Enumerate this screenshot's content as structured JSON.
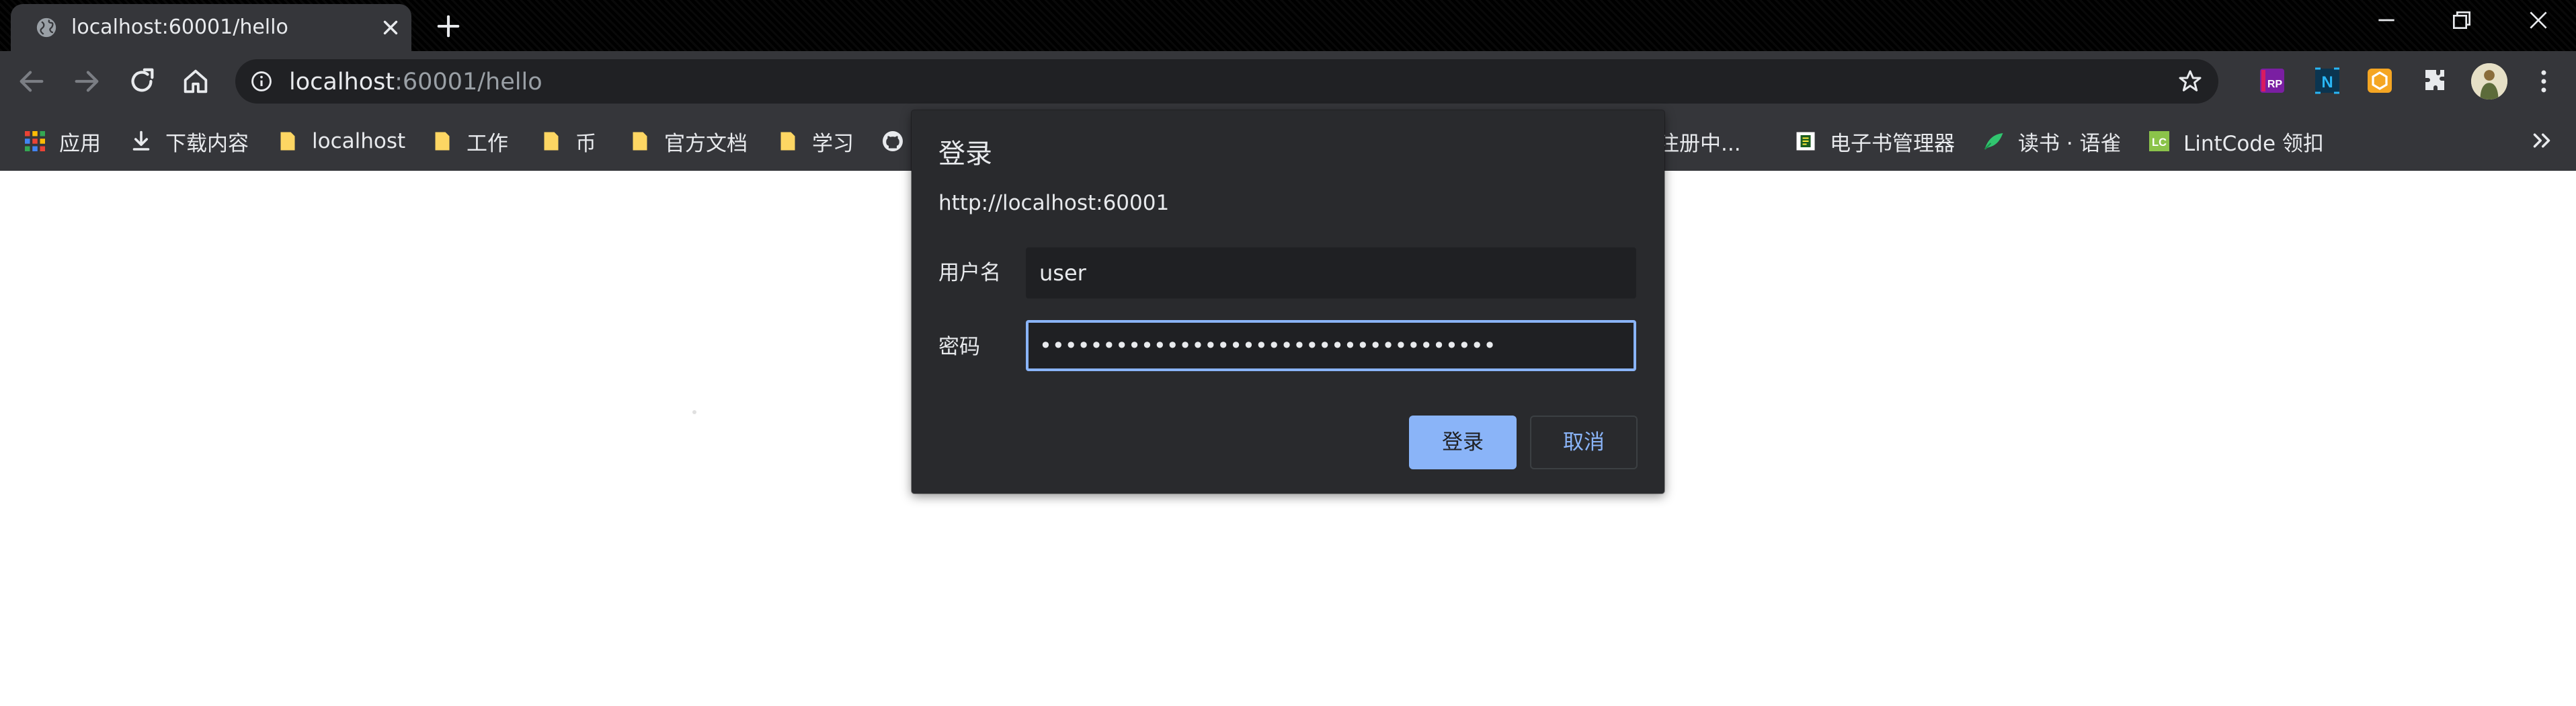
{
  "browser": {
    "tab": {
      "title": "localhost:60001/hello"
    },
    "address_bar": {
      "host": "localhost",
      "rest": ":60001/hello"
    }
  },
  "bookmarks": [
    {
      "label": "应用",
      "icon": "apps-grid-icon"
    },
    {
      "label": "下载内容",
      "icon": "download-icon"
    },
    {
      "label": "localhost",
      "icon": "folder-icon"
    },
    {
      "label": "工作",
      "icon": "folder-icon"
    },
    {
      "label": "币",
      "icon": "folder-icon"
    },
    {
      "label": "官方文档",
      "icon": "folder-icon"
    },
    {
      "label": "学习",
      "icon": "folder-icon"
    },
    {
      "label": "",
      "icon": "github-icon"
    },
    {
      "label": "务注册中...",
      "icon": ""
    },
    {
      "label": "电子书管理器",
      "icon": "ebook-icon"
    },
    {
      "label": "读书 · 语雀",
      "icon": "yuque-bird-icon"
    },
    {
      "label": "LintCode 领扣",
      "icon": "lintcode-icon"
    }
  ],
  "login_dialog": {
    "title": "登录",
    "origin": "http://localhost:60001",
    "username_label": "用户名",
    "username_value": "user",
    "password_label": "密码",
    "password_value": "••••••••••••••••••••••••••••••••••••",
    "login_button": "登录",
    "cancel_button": "取消"
  },
  "colors": {
    "accent": "#8ab4f8",
    "dialog_bg": "#292a2d",
    "toolbar_bg": "#35363a",
    "titlebar_bg": "#000000"
  }
}
